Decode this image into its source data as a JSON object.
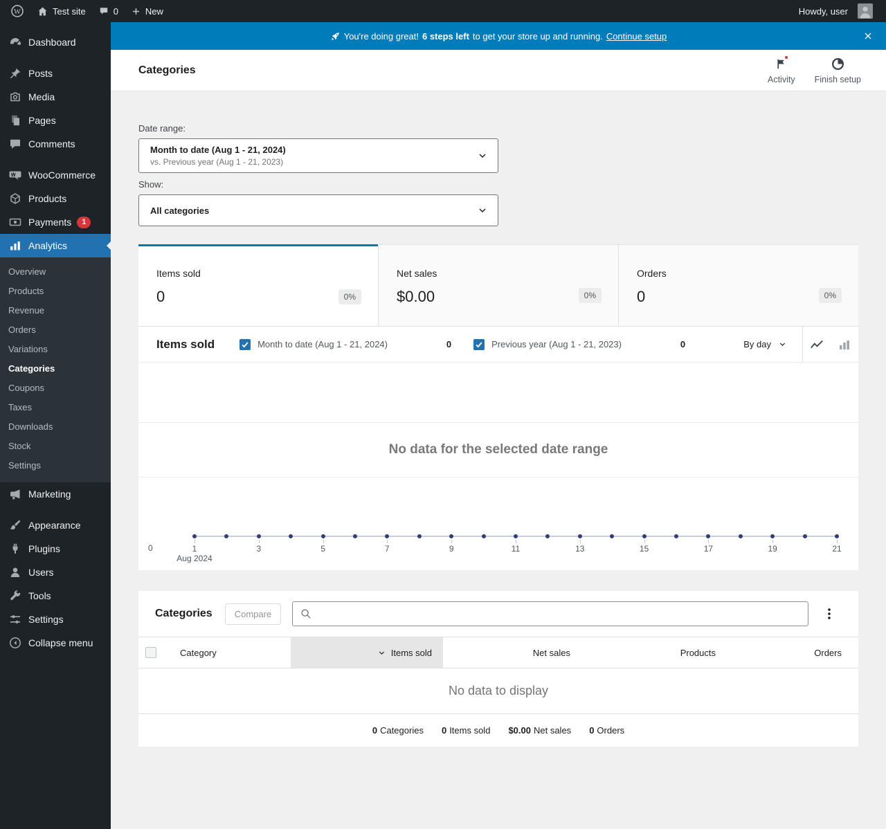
{
  "colors": {
    "banner_blue": "#007cba",
    "accent": "#2271b1",
    "tab_active_border": "#007cba",
    "badge_red": "#d63638",
    "chart_dot": "#2f4077",
    "chart_line": "#c9cede",
    "sidebar_bg": "#1d2327",
    "submenu_bg": "#2c3338"
  },
  "icons": {
    "wordpress-logo-icon": "W in circle",
    "home-icon": "house",
    "comments-bubble-icon": "speech bubble",
    "plus-icon": "+",
    "rocket-icon": "rocket",
    "close-icon": "x",
    "flag-icon": "flag with red dot",
    "progress-circle-icon": "circle with quarter pie",
    "chevron-down-icon": "v",
    "checkbox-checked-icon": "blue box with white check",
    "line-chart-icon": "trend line",
    "bar-chart-icon": "bars",
    "search-icon": "magnifier",
    "kebab-icon": "vertical ellipsis"
  },
  "admin_bar": {
    "site_name": "Test site",
    "comments_count": "0",
    "new_label": "New",
    "howdy_text": "Howdy, user"
  },
  "sidebar": {
    "items": [
      {
        "label": "Dashboard"
      },
      {
        "label": "Posts"
      },
      {
        "label": "Media"
      },
      {
        "label": "Pages"
      },
      {
        "label": "Comments"
      },
      {
        "label": "WooCommerce"
      },
      {
        "label": "Products"
      },
      {
        "label": "Payments",
        "badge": "1"
      },
      {
        "label": "Analytics"
      },
      {
        "label": "Marketing"
      },
      {
        "label": "Appearance"
      },
      {
        "label": "Plugins"
      },
      {
        "label": "Users"
      },
      {
        "label": "Tools"
      },
      {
        "label": "Settings"
      },
      {
        "label": "Collapse menu"
      }
    ],
    "analytics_submenu": [
      {
        "label": "Overview"
      },
      {
        "label": "Products"
      },
      {
        "label": "Revenue"
      },
      {
        "label": "Orders"
      },
      {
        "label": "Variations"
      },
      {
        "label": "Categories"
      },
      {
        "label": "Coupons"
      },
      {
        "label": "Taxes"
      },
      {
        "label": "Downloads"
      },
      {
        "label": "Stock"
      },
      {
        "label": "Settings"
      }
    ]
  },
  "banner": {
    "rocket_emoji": "🚀",
    "message_intro": "You're doing great!",
    "steps_left": "6 steps left",
    "message_rest": "to get your store up and running.",
    "link_label": "Continue setup"
  },
  "header": {
    "page_title": "Categories",
    "activity_label": "Activity",
    "finish_setup_label": "Finish setup"
  },
  "filters": {
    "date_range_label": "Date range:",
    "date_range_value": "Month to date (Aug 1 - 21, 2024)",
    "date_range_compare": "vs. Previous year (Aug 1 - 21, 2023)",
    "show_label": "Show:",
    "show_value": "All categories"
  },
  "summary_tabs": [
    {
      "label": "Items sold",
      "value": "0",
      "delta": "0%",
      "active": true
    },
    {
      "label": "Net sales",
      "value": "$0.00",
      "delta": "0%",
      "active": false
    },
    {
      "label": "Orders",
      "value": "0",
      "delta": "0%",
      "active": false
    }
  ],
  "chart": {
    "title": "Items sold",
    "legend": [
      {
        "label": "Month to date (Aug 1 - 21, 2024)",
        "value": "0",
        "checked": true
      },
      {
        "label": "Previous year (Aug 1 - 21, 2023)",
        "value": "0",
        "checked": true
      }
    ],
    "interval_value": "By day",
    "empty_message": "No data for the selected date range",
    "y_zero_label": "0",
    "x_tick_days": [
      1,
      3,
      5,
      7,
      9,
      11,
      13,
      15,
      17,
      19,
      21
    ],
    "x_month_label": "Aug 2024",
    "days_total": 21
  },
  "chart_data": {
    "type": "line",
    "title": "Items sold",
    "x": [
      1,
      2,
      3,
      4,
      5,
      6,
      7,
      8,
      9,
      10,
      11,
      12,
      13,
      14,
      15,
      16,
      17,
      18,
      19,
      20,
      21
    ],
    "series": [
      {
        "name": "Month to date (Aug 1 - 21, 2024)",
        "values": [
          0,
          0,
          0,
          0,
          0,
          0,
          0,
          0,
          0,
          0,
          0,
          0,
          0,
          0,
          0,
          0,
          0,
          0,
          0,
          0,
          0
        ]
      },
      {
        "name": "Previous year (Aug 1 - 21, 2023)",
        "values": [
          0,
          0,
          0,
          0,
          0,
          0,
          0,
          0,
          0,
          0,
          0,
          0,
          0,
          0,
          0,
          0,
          0,
          0,
          0,
          0,
          0
        ]
      }
    ],
    "xlabel": "Aug 2024",
    "ylabel": "",
    "ylim": [
      0,
      0
    ],
    "legend_position": "top",
    "annotation": "No data for the selected date range"
  },
  "table": {
    "title": "Categories",
    "compare_button": "Compare",
    "search_placeholder": "",
    "columns": [
      "Category",
      "Items sold",
      "Net sales",
      "Products",
      "Orders"
    ],
    "sorted_column": "Items sold",
    "sort_direction": "desc",
    "empty_message": "No data to display",
    "summary": [
      {
        "value": "0",
        "label": "Categories"
      },
      {
        "value": "0",
        "label": "Items sold"
      },
      {
        "value": "$0.00",
        "label": "Net sales"
      },
      {
        "value": "0",
        "label": "Orders"
      }
    ]
  }
}
